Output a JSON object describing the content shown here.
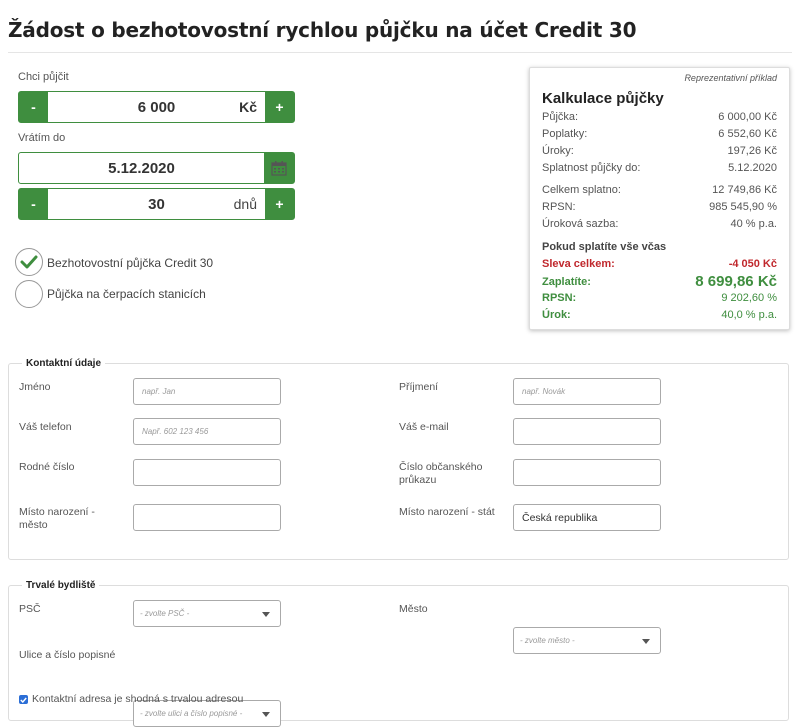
{
  "page": {
    "title": "Žádost o bezhotovostní rychlou půjčku na účet Credit 30"
  },
  "loan": {
    "amount_label": "Chci půjčit",
    "amount_value": "6 000",
    "amount_unit": "Kč",
    "minus": "-",
    "plus": "+",
    "return_label": "Vrátím do",
    "return_date": "5.12.2020",
    "days_value": "30",
    "days_unit": "dnů"
  },
  "loan_types": [
    {
      "label": "Bezhotovostní půjčka Credit 30",
      "selected": true
    },
    {
      "label": "Půjčka na čerpacích stanicích",
      "selected": false
    }
  ],
  "calc": {
    "representative": "Reprezentativní příklad",
    "title": "Kalkulace půjčky",
    "rows": [
      {
        "label": "Půjčka:",
        "value": "6 000,00 Kč"
      },
      {
        "label": "Poplatky:",
        "value": "6 552,60 Kč"
      },
      {
        "label": "Úroky:",
        "value": "197,26 Kč"
      },
      {
        "label": "Splatnost půjčky do:",
        "value": "5.12.2020"
      },
      {
        "label": "Celkem splatno:",
        "value": "12 749,86 Kč"
      },
      {
        "label": "RPSN:",
        "value": "985 545,90 %"
      },
      {
        "label": "Úroková sazba:",
        "value": "40 % p.a."
      }
    ],
    "ontime_heading": "Pokud splatíte vše včas",
    "discount_label": "Sleva celkem:",
    "discount_value": "-4 050 Kč",
    "pay_label": "Zaplatíte:",
    "pay_value": "8 699,86 Kč",
    "rpsn_label": "RPSN:",
    "rpsn_value": "9 202,60 %",
    "rate_label": "Úrok:",
    "rate_value": "40,0 % p.a."
  },
  "contact": {
    "legend": "Kontaktní údaje",
    "first_name_label": "Jméno",
    "first_name_placeholder": "např. Jan",
    "last_name_label": "Příjmení",
    "last_name_placeholder": "např. Novák",
    "phone_label": "Váš telefon",
    "phone_placeholder": "Např. 602 123 456",
    "email_label": "Váš e-mail",
    "birth_number_label": "Rodné číslo",
    "id_card_label": "Číslo občanského průkazu",
    "birth_place_city_label": "Místo narození - město",
    "birth_place_country_label": "Místo narození - stát",
    "birth_place_country_value": "Česká republika"
  },
  "address": {
    "legend": "Trvalé bydliště",
    "zip_label": "PSČ",
    "zip_placeholder": "- zvolte PSČ -",
    "city_label": "Město",
    "city_placeholder": "- zvolte město -",
    "street_label": "Ulice a číslo popisné",
    "street_placeholder": "- zvolte ulici a číslo popisné -",
    "same_address_label": "Kontaktní adresa je shodná s trvalou adresou"
  },
  "colors": {
    "accent": "#3f8e3f",
    "danger": "#c0282d",
    "checkbox": "#2b6ed6"
  }
}
